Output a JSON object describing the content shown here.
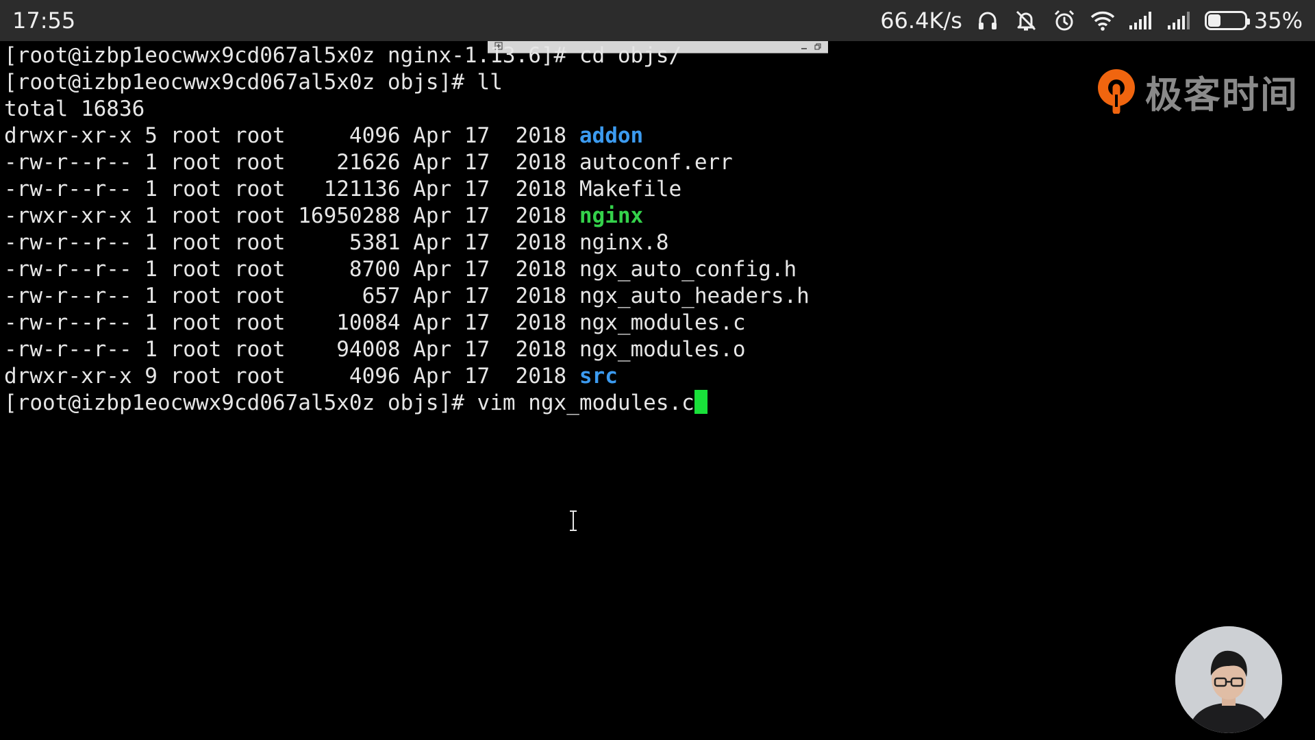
{
  "status_bar": {
    "time": "17:55",
    "network_speed": "66.4K/s",
    "battery_percent": "35%",
    "battery_level": 0.35,
    "icons": [
      "headphones-icon",
      "mute-bell-icon",
      "alarm-icon",
      "wifi-icon",
      "signal-icon",
      "signal-icon"
    ]
  },
  "terminal": {
    "lines": [
      {
        "parts": [
          {
            "text": "[root@izbp1eocwwx9cd067al5x0z nginx-1.13.6]# cd objs/",
            "kind": "plain"
          }
        ]
      },
      {
        "parts": [
          {
            "text": "[root@izbp1eocwwx9cd067al5x0z objs]# ll",
            "kind": "plain"
          }
        ]
      },
      {
        "parts": [
          {
            "text": "total 16836",
            "kind": "plain"
          }
        ]
      },
      {
        "parts": [
          {
            "text": "drwxr-xr-x 5 root root     4096 Apr 17  2018 ",
            "kind": "plain"
          },
          {
            "text": "addon",
            "kind": "dir"
          }
        ]
      },
      {
        "parts": [
          {
            "text": "-rw-r--r-- 1 root root    21626 Apr 17  2018 autoconf.err",
            "kind": "plain"
          }
        ]
      },
      {
        "parts": [
          {
            "text": "-rw-r--r-- 1 root root   121136 Apr 17  2018 Makefile",
            "kind": "plain"
          }
        ]
      },
      {
        "parts": [
          {
            "text": "-rwxr-xr-x 1 root root 16950288 Apr 17  2018 ",
            "kind": "plain"
          },
          {
            "text": "nginx",
            "kind": "exe"
          }
        ]
      },
      {
        "parts": [
          {
            "text": "-rw-r--r-- 1 root root     5381 Apr 17  2018 nginx.8",
            "kind": "plain"
          }
        ]
      },
      {
        "parts": [
          {
            "text": "-rw-r--r-- 1 root root     8700 Apr 17  2018 ngx_auto_config.h",
            "kind": "plain"
          }
        ]
      },
      {
        "parts": [
          {
            "text": "-rw-r--r-- 1 root root      657 Apr 17  2018 ngx_auto_headers.h",
            "kind": "plain"
          }
        ]
      },
      {
        "parts": [
          {
            "text": "-rw-r--r-- 1 root root    10084 Apr 17  2018 ngx_modules.c",
            "kind": "plain"
          }
        ]
      },
      {
        "parts": [
          {
            "text": "-rw-r--r-- 1 root root    94008 Apr 17  2018 ngx_modules.o",
            "kind": "plain"
          }
        ]
      },
      {
        "parts": [
          {
            "text": "drwxr-xr-x 9 root root     4096 Apr 17  2018 ",
            "kind": "plain"
          },
          {
            "text": "src",
            "kind": "dir"
          }
        ]
      },
      {
        "parts": [
          {
            "text": "[root@izbp1eocwwx9cd067al5x0z objs]# vim ngx_modules.c",
            "kind": "plain"
          }
        ],
        "cursor": true
      }
    ]
  },
  "logo": {
    "text": "极客时间"
  },
  "colors": {
    "directory": "#3c9bf0",
    "executable": "#34d24b",
    "cursor": "#19e13a",
    "logo_orange": "#f0650f"
  }
}
